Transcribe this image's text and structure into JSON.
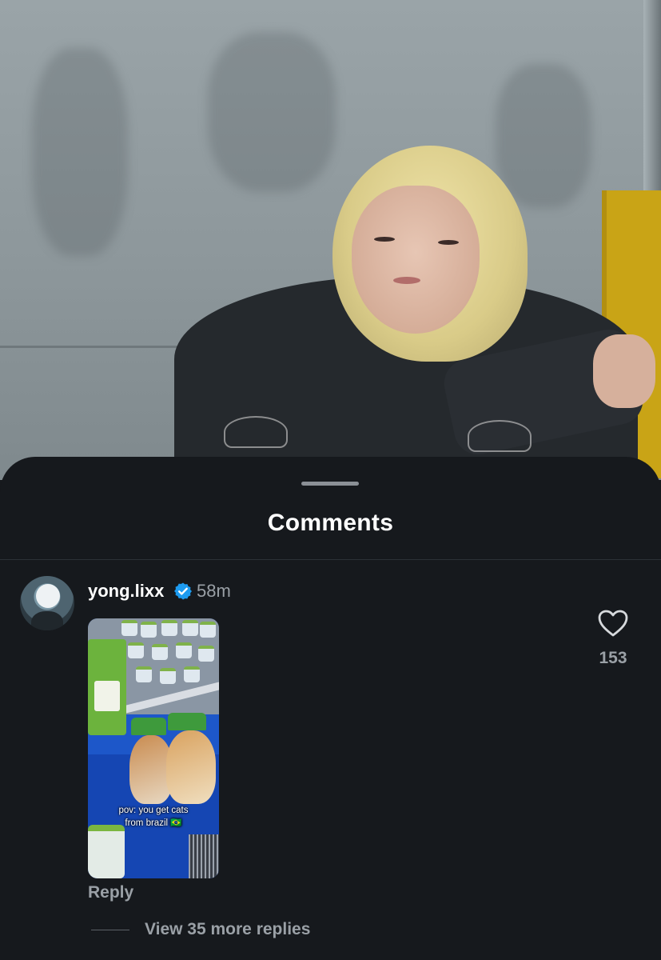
{
  "sheet": {
    "title": "Comments"
  },
  "comment": {
    "username": "yong.lixx",
    "verified": true,
    "timestamp": "58m",
    "like_count": "153",
    "media_caption_line1": "pov: you get cats",
    "media_caption_line2": "from brazil 🇧🇷",
    "reply_label": "Reply",
    "view_more_label": "View 35 more replies"
  },
  "icons": {
    "verified": "verified-badge-icon",
    "like": "heart-outline-icon"
  },
  "colors": {
    "background": "#16191d",
    "text_primary": "#ffffff",
    "text_secondary": "#9aa0a6",
    "verified_blue": "#1d9bf0"
  }
}
